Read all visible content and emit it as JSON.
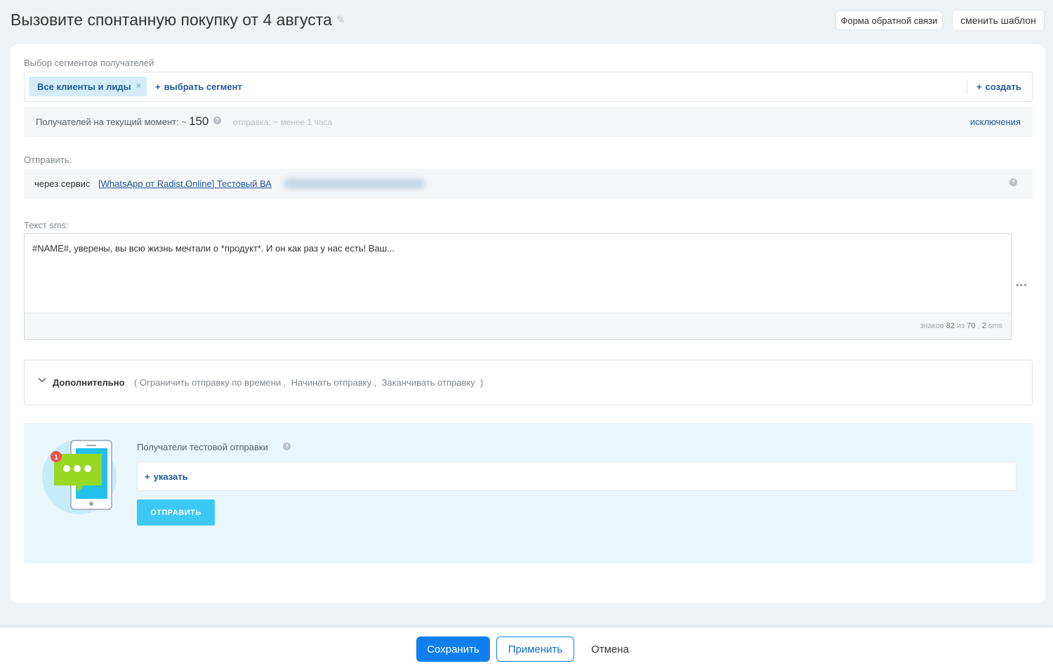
{
  "header": {
    "title": "Вызовите спонтанную покупку от 4 августа",
    "feedback_label": "Форма обратной связи",
    "template_label": "сменить шаблон"
  },
  "segments": {
    "label": "Выбор сегментов получателей",
    "chip_label": "Все клиенты и лиды",
    "chip_remove": "×",
    "add_label": "выбрать сегмент",
    "create_label": "создать"
  },
  "recipients": {
    "label": "Получателей на текущий момент: ~",
    "count": "150",
    "help": "?",
    "eta": "отправка: ~ менее 1 часа",
    "exclusions_label": "исключения"
  },
  "send_via": {
    "label": "Отправить:",
    "prefix": "через сервис",
    "service_link": "[WhatsApp от Radist.Online] Тестовый ВА",
    "help": "?"
  },
  "sms": {
    "label": "Текст sms:",
    "text": "#NAME#, уверены, вы всю жизнь мечтали о *продукт*. И он как раз у нас есть! Ваш...",
    "counter_prefix": "знаков",
    "chars": "82",
    "of_word": "из",
    "limit": "70",
    "sms_count": "2",
    "sms_suffix": "sms",
    "more": "•••"
  },
  "additional": {
    "title": "Дополнительно",
    "open_paren": "(",
    "options": [
      "Ограничить отправку по времени",
      "Начинать отправку",
      "Заканчивать отправку"
    ],
    "close_paren": ")"
  },
  "test_send": {
    "label": "Получатели тестовой отправки",
    "help": "?",
    "specify_label": "указать",
    "send_label": "ОТПРАВИТЬ",
    "badge_count": "1"
  },
  "footer": {
    "save_label": "Сохранить",
    "apply_label": "Применить",
    "cancel_label": "Отмена"
  },
  "colors": {
    "accent": "#0f7ff0",
    "link": "#1c5a9e",
    "send_button": "#3bc8f5",
    "chip_bg": "#d3eef9",
    "test_panel_bg": "#e9f7fd"
  },
  "icons": [
    "pencil-icon",
    "close-icon",
    "plus-icon",
    "help-icon",
    "more-icon",
    "chevron-down-icon",
    "phone-chat-icon"
  ]
}
